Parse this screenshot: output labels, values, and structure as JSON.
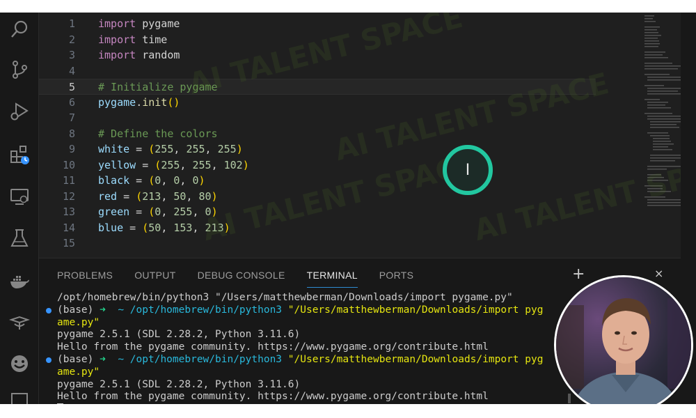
{
  "editor": {
    "lines": [
      {
        "n": "1",
        "tokens": [
          {
            "t": "import",
            "c": "kw"
          },
          {
            "t": " pygame",
            "c": "mod"
          }
        ]
      },
      {
        "n": "2",
        "tokens": [
          {
            "t": "import",
            "c": "kw"
          },
          {
            "t": " time",
            "c": "mod"
          }
        ]
      },
      {
        "n": "3",
        "tokens": [
          {
            "t": "import",
            "c": "kw"
          },
          {
            "t": " random",
            "c": "mod"
          }
        ]
      },
      {
        "n": "4",
        "tokens": []
      },
      {
        "n": "5",
        "active": true,
        "tokens": [
          {
            "t": "# Initialize pygame",
            "c": "cm"
          }
        ]
      },
      {
        "n": "6",
        "tokens": [
          {
            "t": "pygame",
            "c": "var"
          },
          {
            "t": ".",
            "c": "op"
          },
          {
            "t": "init",
            "c": "fn"
          },
          {
            "t": "()",
            "c": "par"
          }
        ]
      },
      {
        "n": "7",
        "tokens": []
      },
      {
        "n": "8",
        "tokens": [
          {
            "t": "# Define the colors",
            "c": "cm"
          }
        ]
      },
      {
        "n": "9",
        "tokens": [
          {
            "t": "white",
            "c": "var"
          },
          {
            "t": " = ",
            "c": "op"
          },
          {
            "t": "(",
            "c": "par"
          },
          {
            "t": "255",
            "c": "num"
          },
          {
            "t": ", ",
            "c": "op"
          },
          {
            "t": "255",
            "c": "num"
          },
          {
            "t": ", ",
            "c": "op"
          },
          {
            "t": "255",
            "c": "num"
          },
          {
            "t": ")",
            "c": "par"
          }
        ]
      },
      {
        "n": "10",
        "tokens": [
          {
            "t": "yellow",
            "c": "var"
          },
          {
            "t": " = ",
            "c": "op"
          },
          {
            "t": "(",
            "c": "par"
          },
          {
            "t": "255",
            "c": "num"
          },
          {
            "t": ", ",
            "c": "op"
          },
          {
            "t": "255",
            "c": "num"
          },
          {
            "t": ", ",
            "c": "op"
          },
          {
            "t": "102",
            "c": "num"
          },
          {
            "t": ")",
            "c": "par"
          }
        ]
      },
      {
        "n": "11",
        "tokens": [
          {
            "t": "black",
            "c": "var"
          },
          {
            "t": " = ",
            "c": "op"
          },
          {
            "t": "(",
            "c": "par"
          },
          {
            "t": "0",
            "c": "num"
          },
          {
            "t": ", ",
            "c": "op"
          },
          {
            "t": "0",
            "c": "num"
          },
          {
            "t": ", ",
            "c": "op"
          },
          {
            "t": "0",
            "c": "num"
          },
          {
            "t": ")",
            "c": "par"
          }
        ]
      },
      {
        "n": "12",
        "tokens": [
          {
            "t": "red",
            "c": "var"
          },
          {
            "t": " = ",
            "c": "op"
          },
          {
            "t": "(",
            "c": "par"
          },
          {
            "t": "213",
            "c": "num"
          },
          {
            "t": ", ",
            "c": "op"
          },
          {
            "t": "50",
            "c": "num"
          },
          {
            "t": ", ",
            "c": "op"
          },
          {
            "t": "80",
            "c": "num"
          },
          {
            "t": ")",
            "c": "par"
          }
        ]
      },
      {
        "n": "13",
        "tokens": [
          {
            "t": "green",
            "c": "var"
          },
          {
            "t": " = ",
            "c": "op"
          },
          {
            "t": "(",
            "c": "par"
          },
          {
            "t": "0",
            "c": "num"
          },
          {
            "t": ", ",
            "c": "op"
          },
          {
            "t": "255",
            "c": "num"
          },
          {
            "t": ", ",
            "c": "op"
          },
          {
            "t": "0",
            "c": "num"
          },
          {
            "t": ")",
            "c": "par"
          }
        ]
      },
      {
        "n": "14",
        "tokens": [
          {
            "t": "blue",
            "c": "var"
          },
          {
            "t": " = ",
            "c": "op"
          },
          {
            "t": "(",
            "c": "par"
          },
          {
            "t": "50",
            "c": "num"
          },
          {
            "t": ", ",
            "c": "op"
          },
          {
            "t": "153",
            "c": "num"
          },
          {
            "t": ", ",
            "c": "op"
          },
          {
            "t": "213",
            "c": "num"
          },
          {
            "t": ")",
            "c": "par"
          }
        ]
      },
      {
        "n": "15",
        "tokens": []
      }
    ]
  },
  "watermark": "AI TALENT SPACE",
  "activity_bar": {
    "icons": [
      "search-icon",
      "source-control-icon",
      "run-debug-icon",
      "extensions-icon",
      "remote-explorer-icon",
      "testing-icon",
      "docker-icon",
      "copilot-icon",
      "account-icon"
    ]
  },
  "panel": {
    "tabs": [
      {
        "label": "PROBLEMS"
      },
      {
        "label": "OUTPUT"
      },
      {
        "label": "DEBUG CONSOLE"
      },
      {
        "label": "TERMINAL",
        "active": true
      },
      {
        "label": "PORTS"
      }
    ],
    "plus": "+",
    "close": "×"
  },
  "terminal": {
    "line1": "/opt/homebrew/bin/python3 \"/Users/matthewberman/Downloads/import pygame.py\"",
    "prompt1": {
      "env": "(base)",
      "arrow": "➜",
      "dir": "~",
      "cmd": "/opt/homebrew/bin/python3",
      "arg_a": "\"/Users/matthewberman/Downloads/import pyg",
      "arg_b": "ame.py\""
    },
    "out1": "pygame 2.5.1 (SDL 2.28.2, Python 3.11.6)",
    "out2": "Hello from the pygame community. https://www.pygame.org/contribute.html",
    "prompt2": {
      "env": "(base)",
      "arrow": "➜",
      "dir": "~",
      "cmd": "/opt/homebrew/bin/python3",
      "arg_a": "\"/Users/matthewberman/Downloads/import pyg",
      "arg_b": "ame.py\""
    },
    "out3": "pygame 2.5.1 (SDL 2.28.2, Python 3.11.6)",
    "out4": "Hello from the pygame community. https://www.pygame.org/contribute.html"
  },
  "cursor_glyph": "I",
  "colors": {
    "accent": "#2f8cd3",
    "cursor_ring": "#22c7a0",
    "prompt_green": "#23d18b",
    "path_cyan": "#29b8db",
    "string_yellow": "#e5e510"
  }
}
